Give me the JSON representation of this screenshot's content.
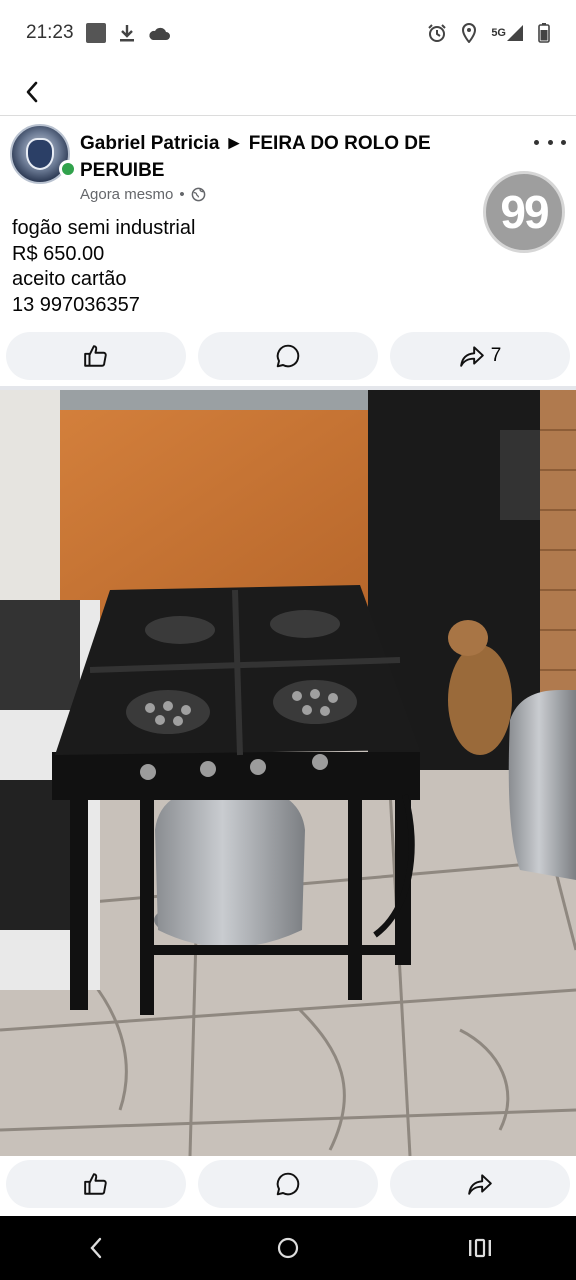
{
  "status_bar": {
    "time": "21:23",
    "network": "5G"
  },
  "post": {
    "author": "Gabriel Patricia ► FEIRA DO ROLO DE PERUIBE",
    "timestamp": "Agora mesmo",
    "separator": "•",
    "badge": "99",
    "lines": [
      "fogão semi industrial",
      "R$ 650.00",
      "aceito cartão",
      "13 997036357"
    ]
  },
  "actions_top": {
    "like_icon": "thumbs-up-icon",
    "comment_icon": "comment-icon",
    "share_icon": "share-icon",
    "share_count": "7"
  },
  "actions_bottom": {
    "like_icon": "thumbs-up-icon",
    "comment_icon": "comment-icon",
    "share_icon": "share-icon"
  },
  "photo": {
    "subject": "semi-industrial stove with gas cylinder"
  },
  "colors": {
    "online": "#31a24c",
    "button_bg": "#f0f2f5",
    "secondary_text": "#65676b"
  }
}
